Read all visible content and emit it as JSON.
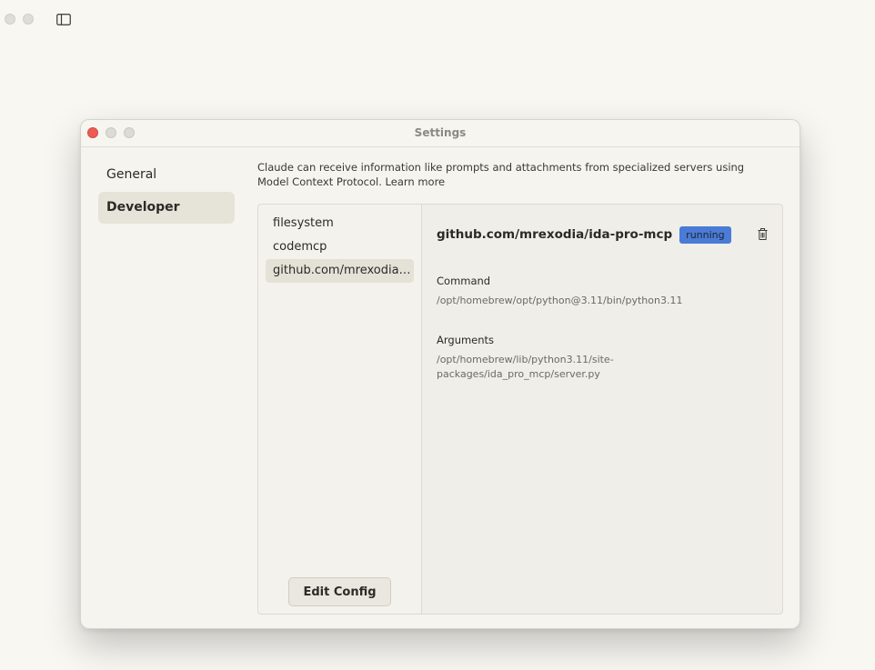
{
  "window": {
    "title": "Settings"
  },
  "nav": {
    "items": [
      {
        "label": "General"
      },
      {
        "label": "Developer"
      }
    ]
  },
  "description": {
    "text": "Claude can receive information like prompts and attachments from specialized servers using Model Context Protocol.",
    "learn_more": "Learn more"
  },
  "servers": [
    {
      "name": "filesystem"
    },
    {
      "name": "codemcp"
    },
    {
      "name": "github.com/mrexodia/ida-pro-mcp"
    }
  ],
  "edit_config_label": "Edit Config",
  "detail": {
    "name": "github.com/mrexodia/ida-pro-mcp",
    "status": "running",
    "command_label": "Command",
    "command_value": "/opt/homebrew/opt/python@3.11/bin/python3.11",
    "arguments_label": "Arguments",
    "arguments_value": "/opt/homebrew/lib/python3.11/site-packages/ida_pro_mcp/server.py"
  },
  "colors": {
    "status_badge": "#4a7bd6",
    "close_button": "#ee5b54",
    "active_nav": "#e6e4d9"
  },
  "icons": {
    "sidebar_toggle": "sidebar-toggle-icon",
    "delete": "trash-icon"
  }
}
